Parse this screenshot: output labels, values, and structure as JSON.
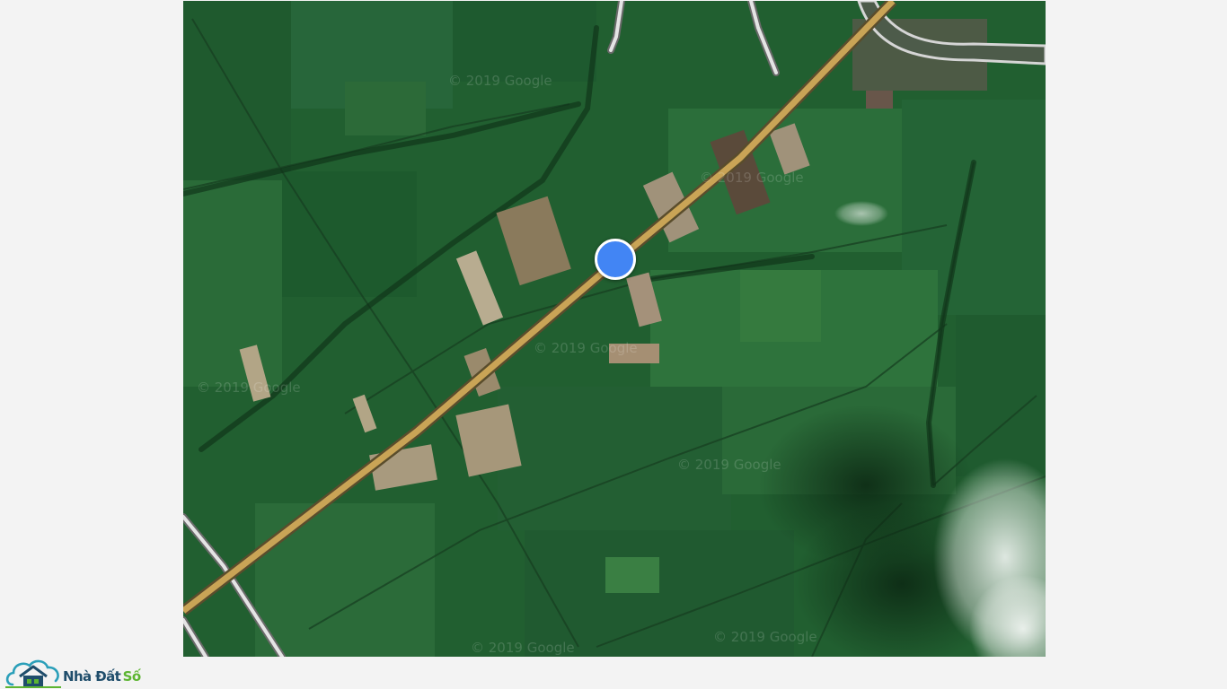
{
  "map": {
    "type": "satellite",
    "watermark_text": "© 2019 Google",
    "marker": {
      "type": "current-location",
      "color": "#4285f4",
      "border_color": "#ffffff"
    },
    "colors": {
      "field_dark": "#1d5a2c",
      "field_mid": "#2a6f37",
      "field_light": "#3c8042",
      "highway": "#c9a456",
      "road_outline": "#6a6a6a",
      "road_fill": "#e4e4e4",
      "river": "#55604f"
    }
  },
  "brand": {
    "name_part1": "Nhà Đất",
    "name_part2": "Số",
    "logo_icon": "cloud-house-icon",
    "colors": {
      "dark": "#1f4d6b",
      "green": "#5cb531",
      "teal": "#2a9fb9"
    }
  }
}
